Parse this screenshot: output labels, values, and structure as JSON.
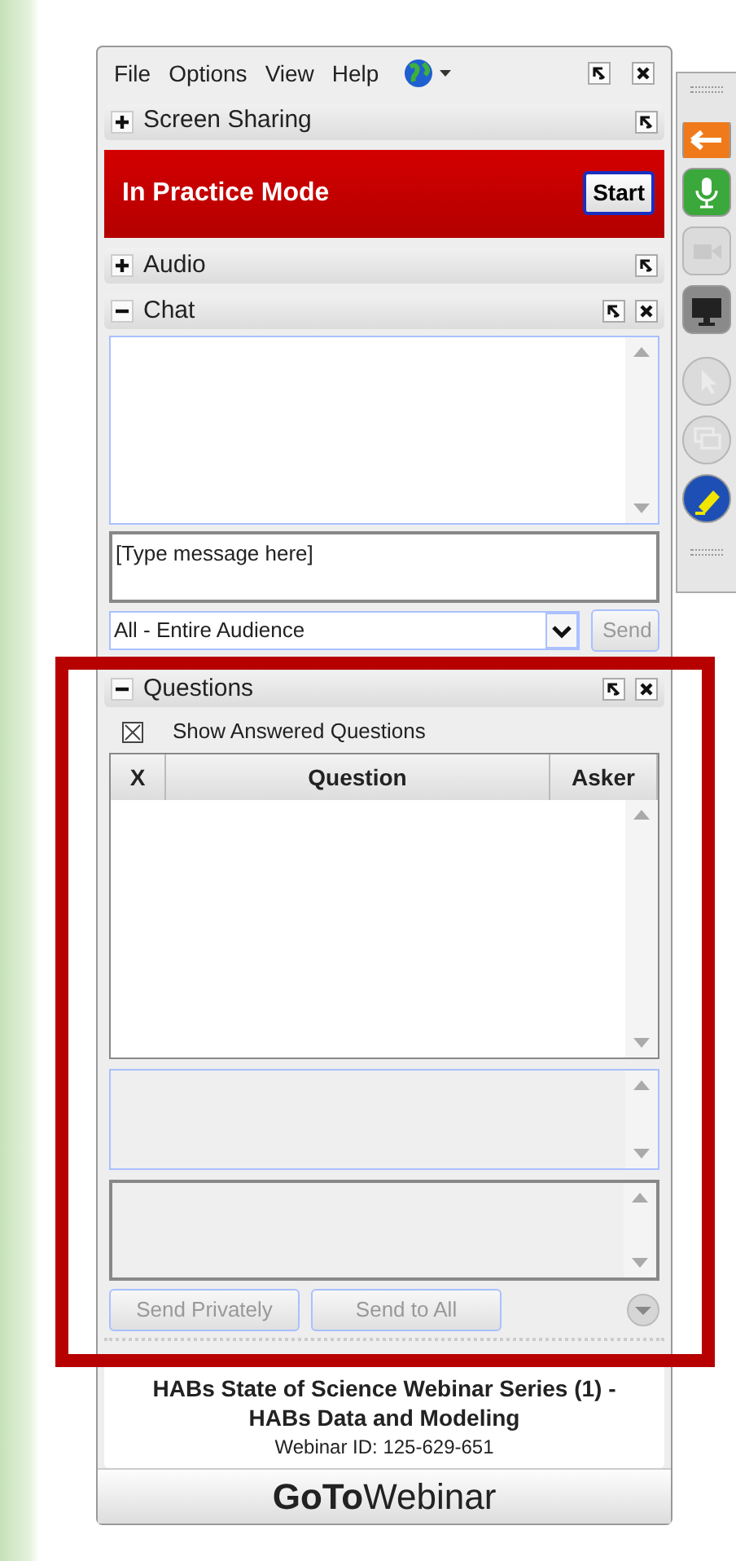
{
  "menu": [
    {
      "label": "File"
    },
    {
      "label": "Options"
    },
    {
      "label": "View"
    },
    {
      "label": "Help"
    }
  ],
  "panels": [
    {
      "kind": "screen",
      "title": "Screen Sharing",
      "expanded": false,
      "closable": false,
      "banner": {
        "text": "In Practice Mode",
        "button": "Start"
      }
    },
    {
      "kind": "audio",
      "title": "Audio",
      "expanded": false,
      "closable": false
    },
    {
      "kind": "chat",
      "title": "Chat",
      "expanded": true,
      "closable": true,
      "placeholder": "[Type message here]",
      "recipient": "All - Entire Audience",
      "send": {
        "label": "Send",
        "disabled": true
      }
    },
    {
      "kind": "questions",
      "title": "Questions",
      "expanded": true,
      "closable": true,
      "show_answered": {
        "label": "Show Answered Questions",
        "checked": true
      },
      "columns": [
        "X",
        "Question",
        "Asker"
      ],
      "buttons": [
        {
          "label": "Send Privately",
          "disabled": true
        },
        {
          "label": "Send to All",
          "disabled": true
        }
      ]
    }
  ],
  "toolbar": [
    {
      "kind": "back",
      "disabled": false
    },
    {
      "kind": "mic",
      "disabled": false
    },
    {
      "kind": "camera",
      "disabled": true
    },
    {
      "kind": "screen",
      "disabled": false
    },
    {
      "kind": "pointer",
      "disabled": true
    },
    {
      "kind": "screens",
      "disabled": true
    },
    {
      "kind": "highlighter",
      "disabled": false
    }
  ],
  "footer": {
    "title": "HABs State of Science Webinar Series (1) - HABs Data and Modeling",
    "webinar_id": "Webinar ID: 125-629-651"
  },
  "logo": {
    "bold": "GoTo",
    "light": "Webinar"
  }
}
